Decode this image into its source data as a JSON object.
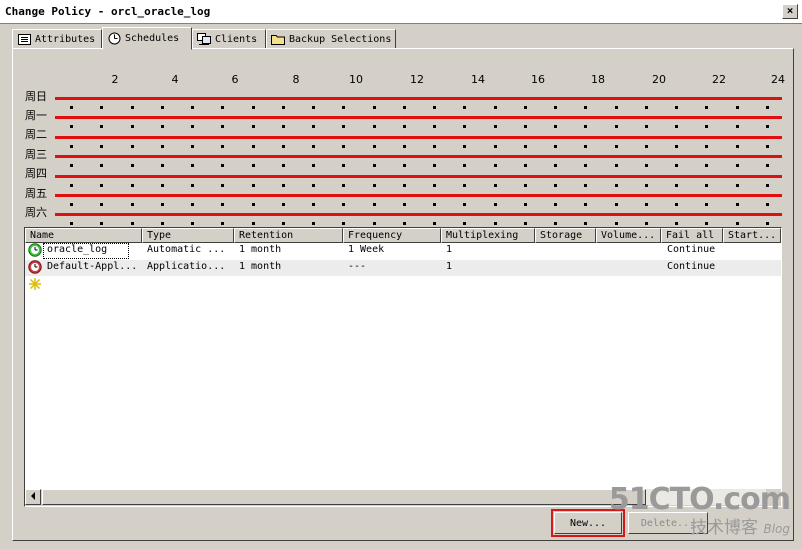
{
  "window": {
    "title": "Change Policy - orcl_oracle_log",
    "close_label": "×"
  },
  "tabs": [
    {
      "label": "Attributes",
      "icon": "attributes-icon"
    },
    {
      "label": "Schedules",
      "icon": "schedules-icon"
    },
    {
      "label": "Clients",
      "icon": "clients-icon"
    },
    {
      "label": "Backup Selections",
      "icon": "folder-icon"
    }
  ],
  "schedule_grid": {
    "hours": [
      "2",
      "4",
      "6",
      "8",
      "10",
      "12",
      "14",
      "16",
      "18",
      "20",
      "22",
      "24"
    ],
    "days": [
      "周日",
      "周一",
      "周二",
      "周三",
      "周四",
      "周五",
      "周六"
    ],
    "line_color": "#e01010"
  },
  "table": {
    "columns": [
      "Name",
      "Type",
      "Retention",
      "Frequency",
      "Multiplexing",
      "Storage",
      "Volume...",
      "Fail all",
      "Start..."
    ],
    "rows": [
      {
        "icon": "schedule-green-icon",
        "name": "oracle_log",
        "type": "Automatic ...",
        "retention": "1 month",
        "frequency": "1 Week",
        "multiplexing": "1",
        "storage": "",
        "volume": "",
        "fail_all": "Continue",
        "start": ""
      },
      {
        "icon": "schedule-red-icon",
        "name": "Default-Appl...",
        "type": "Applicatio...",
        "retention": "1 month",
        "frequency": "---",
        "multiplexing": "1",
        "storage": "",
        "volume": "",
        "fail_all": "Continue",
        "start": ""
      }
    ],
    "new_entry_icon": "new-star-icon"
  },
  "buttons": {
    "new_label": "New...",
    "delete_label": "Delete..."
  },
  "watermark": {
    "line1": "51CTO.com",
    "line2": "技术博客",
    "line2_suffix": "Blog"
  },
  "colors": {
    "highlight": "#d81818",
    "background": "#d4d0c8"
  }
}
